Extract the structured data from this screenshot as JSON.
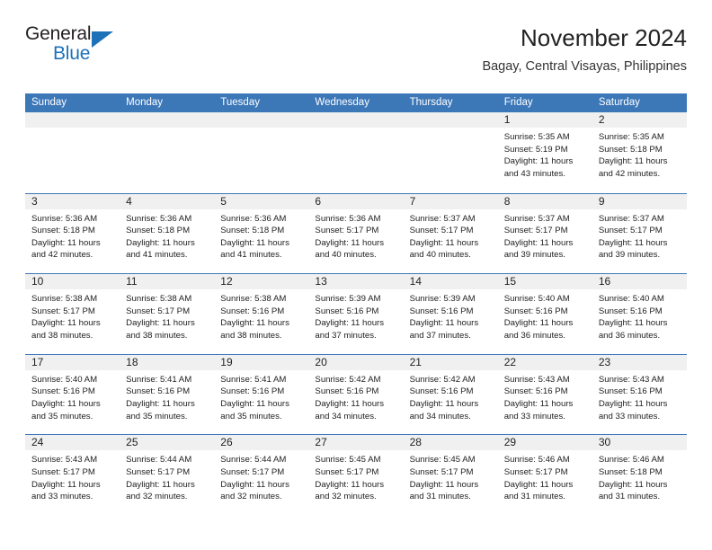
{
  "logo": {
    "word_one": "General",
    "word_two": "Blue",
    "triangle_color": "#1d71b8"
  },
  "header": {
    "title": "November 2024",
    "location": "Bagay, Central Visayas, Philippines"
  },
  "colors": {
    "header_blue": "#3c77b8",
    "daynum_gray": "#f0f0f0",
    "text": "#222222"
  },
  "weekdays": [
    "Sunday",
    "Monday",
    "Tuesday",
    "Wednesday",
    "Thursday",
    "Friday",
    "Saturday"
  ],
  "labels": {
    "sunrise": "Sunrise:",
    "sunset": "Sunset:",
    "daylight": "Daylight:"
  },
  "weeks": [
    [
      {
        "day": "",
        "line1": "",
        "line2": "",
        "line3": "",
        "line4": ""
      },
      {
        "day": "",
        "line1": "",
        "line2": "",
        "line3": "",
        "line4": ""
      },
      {
        "day": "",
        "line1": "",
        "line2": "",
        "line3": "",
        "line4": ""
      },
      {
        "day": "",
        "line1": "",
        "line2": "",
        "line3": "",
        "line4": ""
      },
      {
        "day": "",
        "line1": "",
        "line2": "",
        "line3": "",
        "line4": ""
      },
      {
        "day": "1",
        "line1": "Sunrise: 5:35 AM",
        "line2": "Sunset: 5:19 PM",
        "line3": "Daylight: 11 hours",
        "line4": "and 43 minutes."
      },
      {
        "day": "2",
        "line1": "Sunrise: 5:35 AM",
        "line2": "Sunset: 5:18 PM",
        "line3": "Daylight: 11 hours",
        "line4": "and 42 minutes."
      }
    ],
    [
      {
        "day": "3",
        "line1": "Sunrise: 5:36 AM",
        "line2": "Sunset: 5:18 PM",
        "line3": "Daylight: 11 hours",
        "line4": "and 42 minutes."
      },
      {
        "day": "4",
        "line1": "Sunrise: 5:36 AM",
        "line2": "Sunset: 5:18 PM",
        "line3": "Daylight: 11 hours",
        "line4": "and 41 minutes."
      },
      {
        "day": "5",
        "line1": "Sunrise: 5:36 AM",
        "line2": "Sunset: 5:18 PM",
        "line3": "Daylight: 11 hours",
        "line4": "and 41 minutes."
      },
      {
        "day": "6",
        "line1": "Sunrise: 5:36 AM",
        "line2": "Sunset: 5:17 PM",
        "line3": "Daylight: 11 hours",
        "line4": "and 40 minutes."
      },
      {
        "day": "7",
        "line1": "Sunrise: 5:37 AM",
        "line2": "Sunset: 5:17 PM",
        "line3": "Daylight: 11 hours",
        "line4": "and 40 minutes."
      },
      {
        "day": "8",
        "line1": "Sunrise: 5:37 AM",
        "line2": "Sunset: 5:17 PM",
        "line3": "Daylight: 11 hours",
        "line4": "and 39 minutes."
      },
      {
        "day": "9",
        "line1": "Sunrise: 5:37 AM",
        "line2": "Sunset: 5:17 PM",
        "line3": "Daylight: 11 hours",
        "line4": "and 39 minutes."
      }
    ],
    [
      {
        "day": "10",
        "line1": "Sunrise: 5:38 AM",
        "line2": "Sunset: 5:17 PM",
        "line3": "Daylight: 11 hours",
        "line4": "and 38 minutes."
      },
      {
        "day": "11",
        "line1": "Sunrise: 5:38 AM",
        "line2": "Sunset: 5:17 PM",
        "line3": "Daylight: 11 hours",
        "line4": "and 38 minutes."
      },
      {
        "day": "12",
        "line1": "Sunrise: 5:38 AM",
        "line2": "Sunset: 5:16 PM",
        "line3": "Daylight: 11 hours",
        "line4": "and 38 minutes."
      },
      {
        "day": "13",
        "line1": "Sunrise: 5:39 AM",
        "line2": "Sunset: 5:16 PM",
        "line3": "Daylight: 11 hours",
        "line4": "and 37 minutes."
      },
      {
        "day": "14",
        "line1": "Sunrise: 5:39 AM",
        "line2": "Sunset: 5:16 PM",
        "line3": "Daylight: 11 hours",
        "line4": "and 37 minutes."
      },
      {
        "day": "15",
        "line1": "Sunrise: 5:40 AM",
        "line2": "Sunset: 5:16 PM",
        "line3": "Daylight: 11 hours",
        "line4": "and 36 minutes."
      },
      {
        "day": "16",
        "line1": "Sunrise: 5:40 AM",
        "line2": "Sunset: 5:16 PM",
        "line3": "Daylight: 11 hours",
        "line4": "and 36 minutes."
      }
    ],
    [
      {
        "day": "17",
        "line1": "Sunrise: 5:40 AM",
        "line2": "Sunset: 5:16 PM",
        "line3": "Daylight: 11 hours",
        "line4": "and 35 minutes."
      },
      {
        "day": "18",
        "line1": "Sunrise: 5:41 AM",
        "line2": "Sunset: 5:16 PM",
        "line3": "Daylight: 11 hours",
        "line4": "and 35 minutes."
      },
      {
        "day": "19",
        "line1": "Sunrise: 5:41 AM",
        "line2": "Sunset: 5:16 PM",
        "line3": "Daylight: 11 hours",
        "line4": "and 35 minutes."
      },
      {
        "day": "20",
        "line1": "Sunrise: 5:42 AM",
        "line2": "Sunset: 5:16 PM",
        "line3": "Daylight: 11 hours",
        "line4": "and 34 minutes."
      },
      {
        "day": "21",
        "line1": "Sunrise: 5:42 AM",
        "line2": "Sunset: 5:16 PM",
        "line3": "Daylight: 11 hours",
        "line4": "and 34 minutes."
      },
      {
        "day": "22",
        "line1": "Sunrise: 5:43 AM",
        "line2": "Sunset: 5:16 PM",
        "line3": "Daylight: 11 hours",
        "line4": "and 33 minutes."
      },
      {
        "day": "23",
        "line1": "Sunrise: 5:43 AM",
        "line2": "Sunset: 5:16 PM",
        "line3": "Daylight: 11 hours",
        "line4": "and 33 minutes."
      }
    ],
    [
      {
        "day": "24",
        "line1": "Sunrise: 5:43 AM",
        "line2": "Sunset: 5:17 PM",
        "line3": "Daylight: 11 hours",
        "line4": "and 33 minutes."
      },
      {
        "day": "25",
        "line1": "Sunrise: 5:44 AM",
        "line2": "Sunset: 5:17 PM",
        "line3": "Daylight: 11 hours",
        "line4": "and 32 minutes."
      },
      {
        "day": "26",
        "line1": "Sunrise: 5:44 AM",
        "line2": "Sunset: 5:17 PM",
        "line3": "Daylight: 11 hours",
        "line4": "and 32 minutes."
      },
      {
        "day": "27",
        "line1": "Sunrise: 5:45 AM",
        "line2": "Sunset: 5:17 PM",
        "line3": "Daylight: 11 hours",
        "line4": "and 32 minutes."
      },
      {
        "day": "28",
        "line1": "Sunrise: 5:45 AM",
        "line2": "Sunset: 5:17 PM",
        "line3": "Daylight: 11 hours",
        "line4": "and 31 minutes."
      },
      {
        "day": "29",
        "line1": "Sunrise: 5:46 AM",
        "line2": "Sunset: 5:17 PM",
        "line3": "Daylight: 11 hours",
        "line4": "and 31 minutes."
      },
      {
        "day": "30",
        "line1": "Sunrise: 5:46 AM",
        "line2": "Sunset: 5:18 PM",
        "line3": "Daylight: 11 hours",
        "line4": "and 31 minutes."
      }
    ]
  ]
}
